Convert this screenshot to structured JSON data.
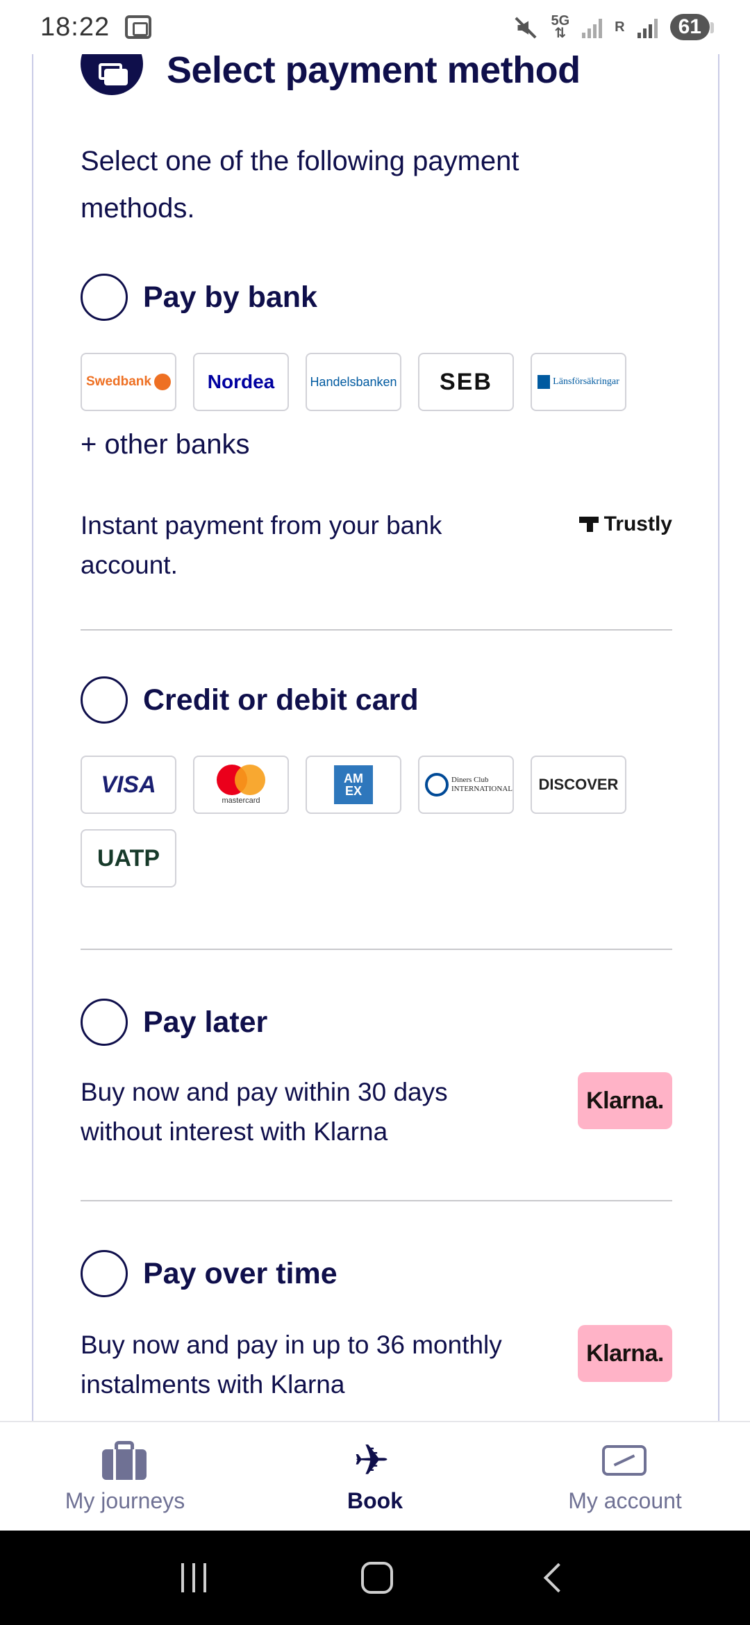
{
  "status_bar": {
    "time": "18:22",
    "network": "5G",
    "roaming": "R",
    "battery": "61"
  },
  "header": {
    "title": "Select payment method"
  },
  "intro": "Select one of the following payment methods.",
  "pay_by_bank": {
    "label": "Pay by bank",
    "banks": [
      "Swedbank",
      "Nordea",
      "Handelsbanken",
      "SEB",
      "Länsförsäkringar"
    ],
    "other_banks": "+ other banks",
    "description": "Instant payment from your bank account.",
    "provider": "Trustly"
  },
  "card": {
    "label": "Credit or debit card",
    "brands": [
      "VISA",
      "mastercard",
      "AM EX",
      "Diners Club INTERNATIONAL",
      "DISCOVER",
      "UATP"
    ]
  },
  "pay_later": {
    "label": "Pay later",
    "description": "Buy now and pay within 30 days without interest with Klarna",
    "provider": "Klarna."
  },
  "pay_over_time": {
    "label": "Pay over time",
    "description": "Buy now and pay in up to 36 monthly instalments with Klarna",
    "provider": "Klarna."
  },
  "bottom_nav": {
    "items": [
      {
        "label": "My journeys",
        "icon": "suitcase-icon"
      },
      {
        "label": "Book",
        "icon": "airplane-icon"
      },
      {
        "label": "My account",
        "icon": "account-card-icon"
      }
    ],
    "active": "Book"
  },
  "colors": {
    "navy": "#0f0f4b",
    "muted": "#6f7194",
    "klarna_pink": "#ffb3c7",
    "card_border": "#c9cbe6"
  }
}
